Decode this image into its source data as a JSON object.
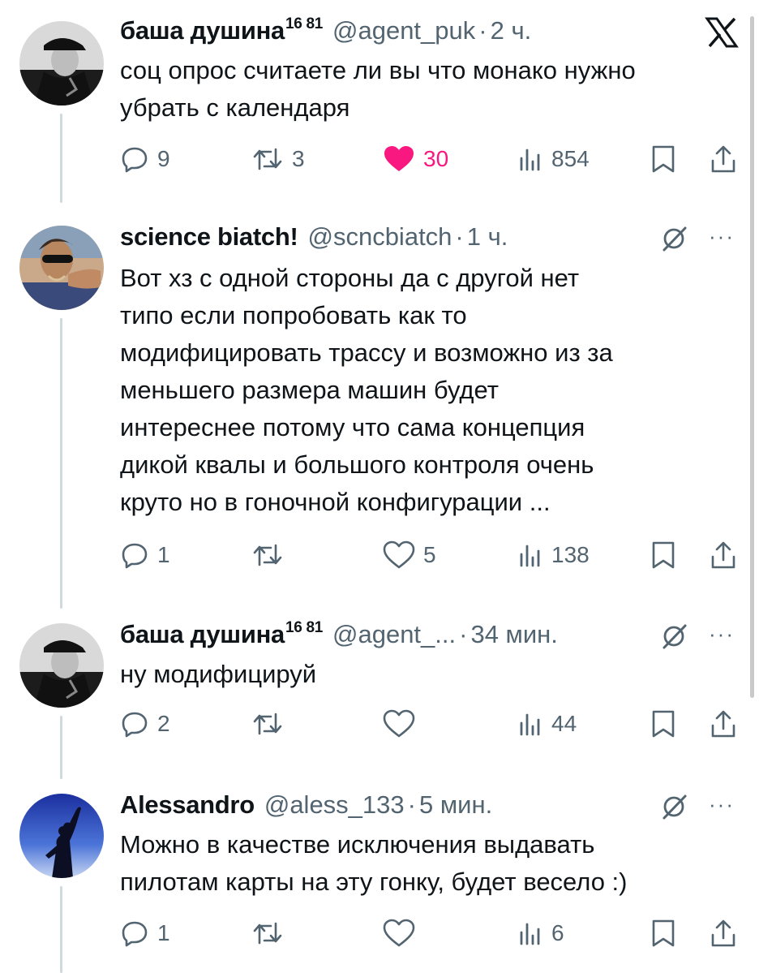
{
  "tweets": [
    {
      "name": "баша душина",
      "name_sup": "16 81",
      "handle": "@agent_puk",
      "time": "2 ч.",
      "text": "соц опрос считаете ли вы что монако нужно\nубрать с календаря",
      "replies": "9",
      "retweets": "3",
      "likes": "30",
      "views": "854",
      "liked": true,
      "corner_icon": "x-logo-icon"
    },
    {
      "name": "science biatch!",
      "name_sup": "",
      "handle": "@scncbiatch",
      "time": "1 ч.",
      "text": "Вот хз с одной стороны да с другой нет\nтипо если попробовать как то\nмодифицировать трассу и возможно из за\nменьшего размера машин будет\nинтереснее потому что сама концепция\nдикой квалы и большого контроля очень\nкруто но в гоночной конфигурации ...",
      "replies": "1",
      "retweets": "",
      "likes": "5",
      "views": "138",
      "liked": false,
      "corner_icon": "grok-icon",
      "more_label": "···"
    },
    {
      "name": "баша душина",
      "name_sup": "16 81",
      "handle": "@agent_...",
      "time": "34 мин.",
      "text": "ну модифицируй",
      "replies": "2",
      "retweets": "",
      "likes": "",
      "views": "44",
      "liked": false,
      "corner_icon": "grok-icon",
      "more_label": "···"
    },
    {
      "name": "Alessandro",
      "name_sup": "",
      "handle": "@aless_133",
      "time": "5 мин.",
      "text": "Можно в качестве исключения выдавать\nпилотам карты на эту гонку, будет весело :)",
      "replies": "1",
      "retweets": "",
      "likes": "",
      "views": "6",
      "liked": false,
      "corner_icon": "grok-icon",
      "more_label": "···"
    }
  ],
  "separator": "·",
  "colors": {
    "text": "#0f1419",
    "secondary": "#536471",
    "like": "#f91880",
    "thread_line": "#cfd9de"
  },
  "icons": [
    "reply-icon",
    "retweet-icon",
    "like-icon",
    "views-icon",
    "bookmark-icon",
    "share-icon",
    "x-logo-icon",
    "grok-icon",
    "more-icon"
  ]
}
